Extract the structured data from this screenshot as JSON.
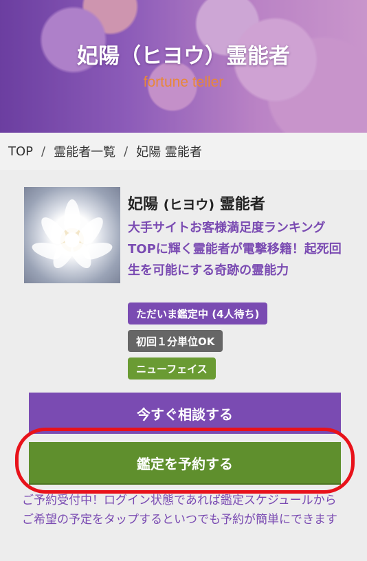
{
  "header": {
    "title": "妃陽（ヒヨウ）霊能者",
    "subtitle": "fortune teller"
  },
  "breadcrumb": {
    "items": [
      "TOP",
      "霊能者一覧",
      "妃陽 霊能者"
    ],
    "separator": "/"
  },
  "profile": {
    "name": "妃陽",
    "kana": "(ヒヨウ)",
    "role": "霊能者",
    "catchphrase": "大手サイトお客様満足度ランキングTOPに輝く霊能者が電撃移籍！起死回生を可能にする奇跡の霊能力",
    "badges": {
      "status": "ただいま鑑定中 (4人待ち)",
      "unit": "初回１分単位OK",
      "new": "ニューフェイス"
    }
  },
  "actions": {
    "consult_label": "今すぐ相談する",
    "reserve_label": "鑑定を予約する"
  },
  "note": "ご予約受付中！ログイン状態であれば鑑定スケジュールからご希望の予定をタップするといつでも予約が簡単にできます",
  "colors": {
    "accent_purple": "#7a4bb2",
    "accent_green": "#5f8f2d",
    "highlight_red": "#e8121a",
    "subtitle_orange": "#e8873a"
  }
}
